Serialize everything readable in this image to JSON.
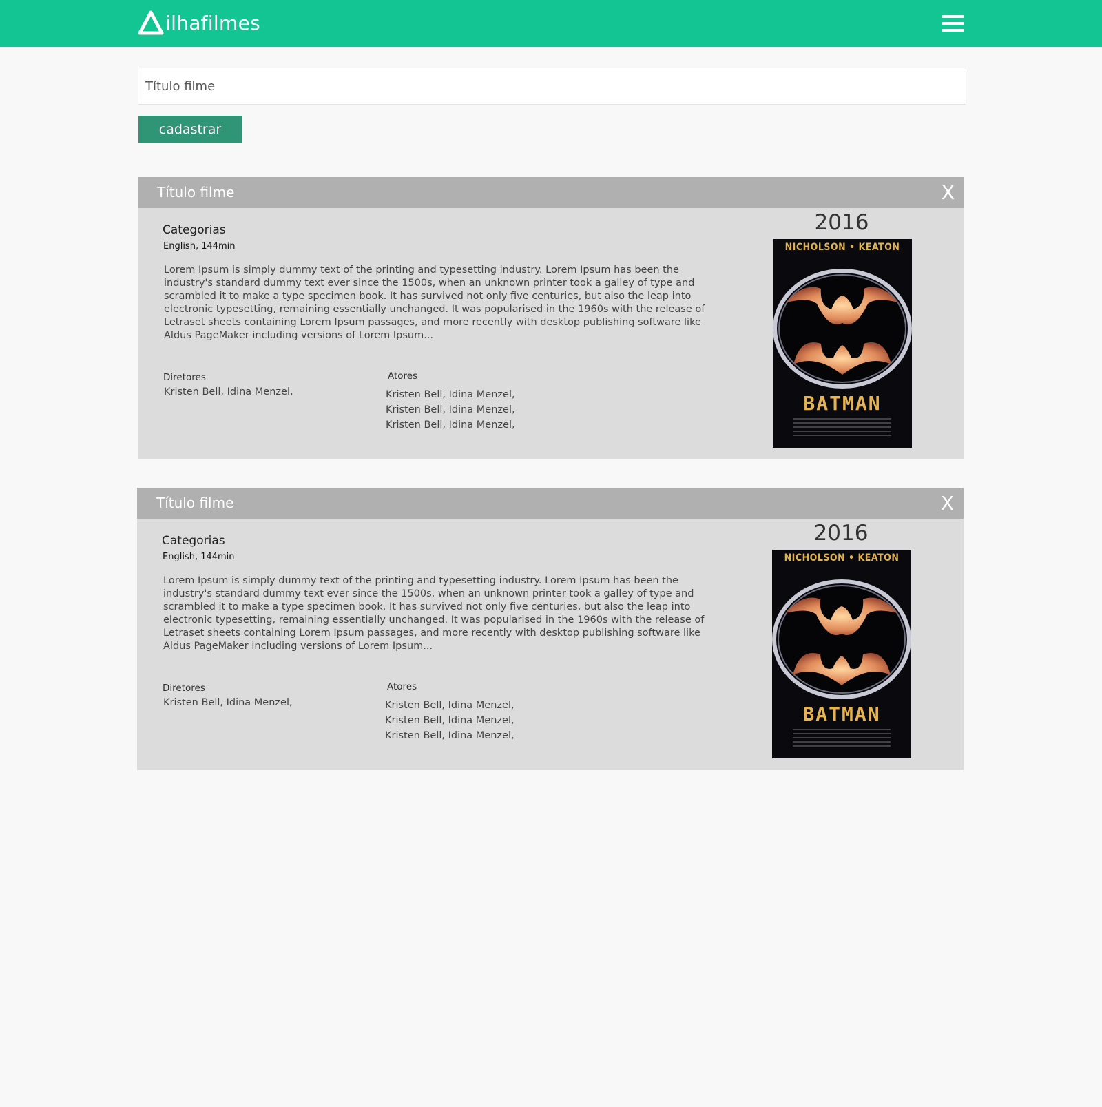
{
  "header": {
    "brand": "ilhafilmes",
    "colors": {
      "bar": "#13c592",
      "button": "#2f9575"
    }
  },
  "form": {
    "title_placeholder": "Título filme",
    "submit_label": "cadastrar"
  },
  "movies": [
    {
      "title": "Título filme",
      "close_label": "X",
      "categories_label": "Categorias",
      "meta": "English, 144min",
      "synopsis": "Lorem Ipsum is simply dummy text of the printing and typesetting industry. Lorem Ipsum has been the industry's standard dummy text ever since the 1500s, when an unknown printer took a galley of type and scrambled it to make a type specimen book. It has survived not only five centuries, but also the leap into electronic typesetting, remaining essentially unchanged. It was popularised in the 1960s with the release of Letraset sheets containing Lorem Ipsum passages, and more recently with desktop publishing software like Aldus PageMaker including versions of Lorem Ipsum...",
      "directors_label": "Diretores",
      "directors": "Kristen Bell, Idina Menzel,",
      "actors_label": "Atores",
      "actors": [
        "Kristen Bell, Idina Menzel,",
        "Kristen Bell, Idina Menzel,",
        "Kristen Bell, Idina Menzel,"
      ],
      "year": "2016",
      "poster": {
        "top_text": "NICHOLSON • KEATON",
        "title_text": "BATMAN"
      }
    },
    {
      "title": "Título filme",
      "close_label": "X",
      "categories_label": "Categorias",
      "meta": "English, 144min",
      "synopsis": "Lorem Ipsum is simply dummy text of the printing and typesetting industry. Lorem Ipsum has been the industry's standard dummy text ever since the 1500s, when an unknown printer took a galley of type and scrambled it to make a type specimen book. It has survived not only five centuries, but also the leap into electronic typesetting, remaining essentially unchanged. It was popularised in the 1960s with the release of Letraset sheets containing Lorem Ipsum passages, and more recently with desktop publishing software like Aldus PageMaker including versions of Lorem Ipsum...",
      "directors_label": "Diretores",
      "directors": "Kristen Bell, Idina Menzel,",
      "actors_label": "Atores",
      "actors": [
        "Kristen Bell, Idina Menzel,",
        "Kristen Bell, Idina Menzel,",
        "Kristen Bell, Idina Menzel,"
      ],
      "year": "2016",
      "poster": {
        "top_text": "NICHOLSON • KEATON",
        "title_text": "BATMAN"
      }
    }
  ]
}
